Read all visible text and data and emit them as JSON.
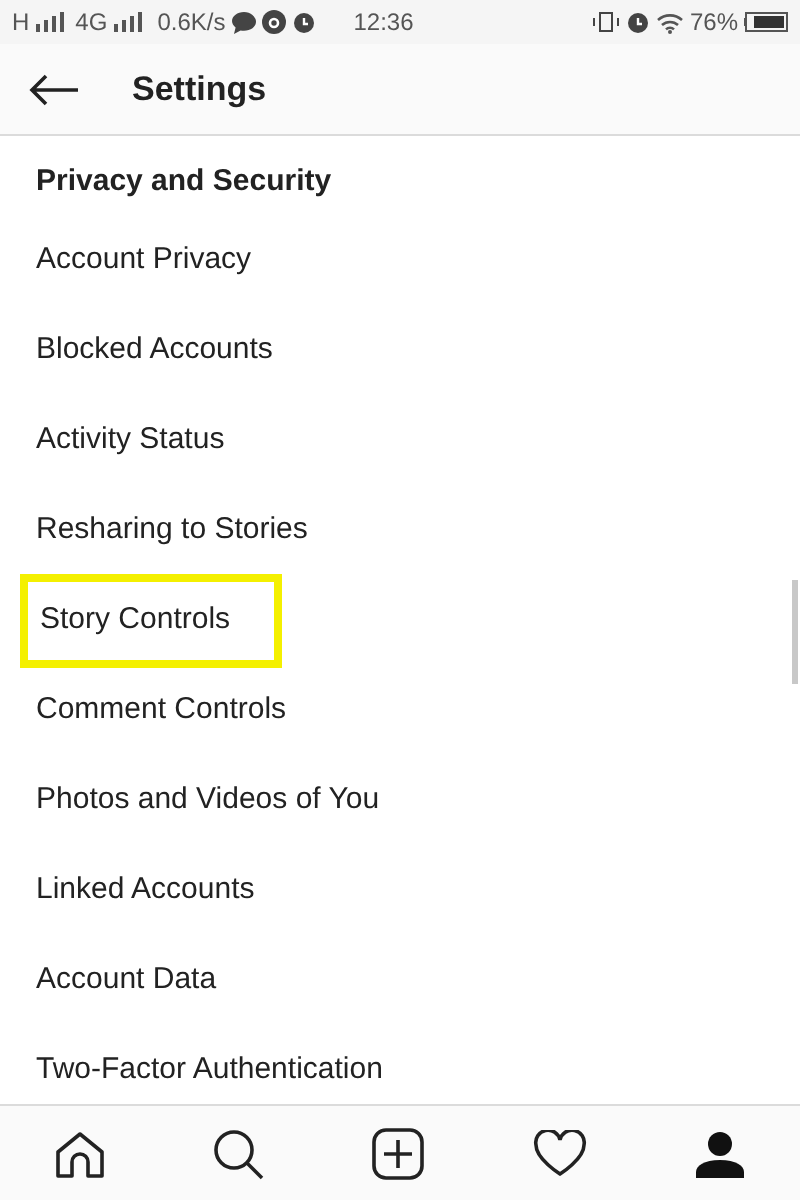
{
  "status_bar": {
    "network_1": "H",
    "network_2": "4G",
    "speed": "0.6K/s",
    "time": "12:36",
    "battery": "76%"
  },
  "header": {
    "title": "Settings"
  },
  "section": {
    "title": "Privacy and Security"
  },
  "items": [
    {
      "label": "Account Privacy",
      "highlighted": false
    },
    {
      "label": "Blocked Accounts",
      "highlighted": false
    },
    {
      "label": "Activity Status",
      "highlighted": false
    },
    {
      "label": "Resharing to Stories",
      "highlighted": false
    },
    {
      "label": "Story Controls",
      "highlighted": true
    },
    {
      "label": "Comment Controls",
      "highlighted": false
    },
    {
      "label": "Photos and Videos of You",
      "highlighted": false
    },
    {
      "label": "Linked Accounts",
      "highlighted": false
    },
    {
      "label": "Account Data",
      "highlighted": false
    },
    {
      "label": "Two-Factor Authentication",
      "highlighted": false
    }
  ]
}
